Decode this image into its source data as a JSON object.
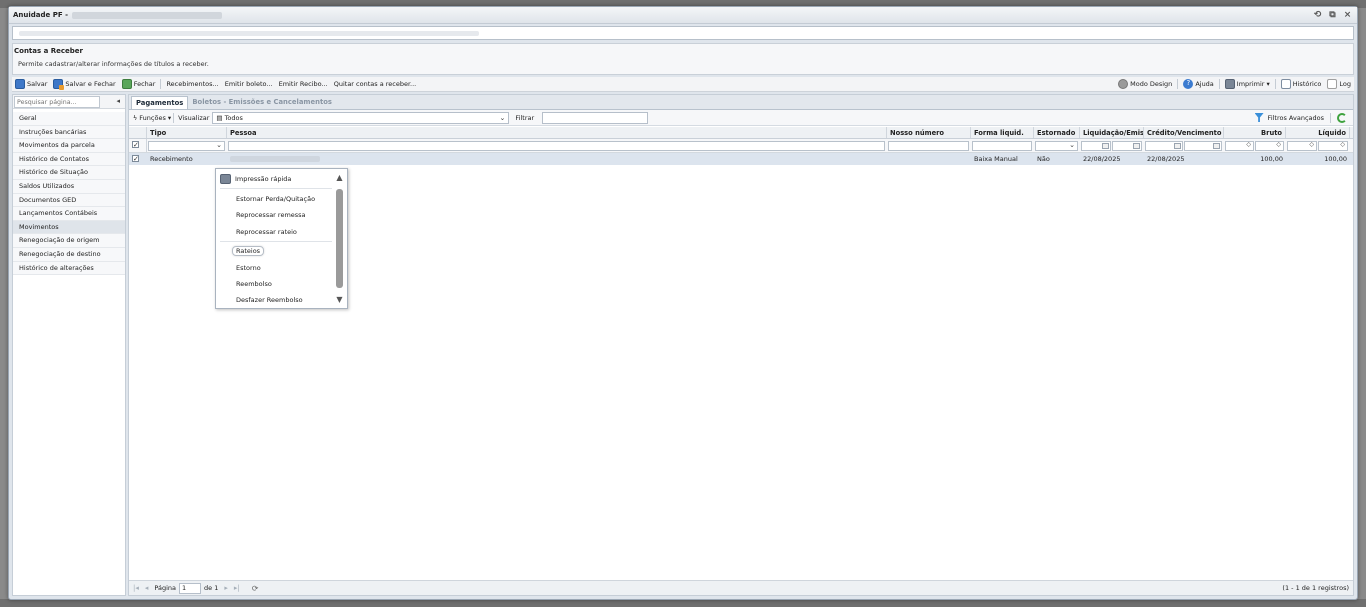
{
  "window": {
    "title": "Anuidade PF -",
    "controls": [
      "refresh-icon",
      "popout-icon",
      "close-icon"
    ]
  },
  "page": {
    "title": "Contas a Receber",
    "description": "Permite cadastrar/alterar informações de títulos a receber."
  },
  "toolbar": {
    "save": "Salvar",
    "save_close": "Salvar e Fechar",
    "close": "Fechar",
    "receipts": "Recebimentos...",
    "emit_boleto": "Emitir boleto...",
    "emit_recibo": "Emitir Recibo...",
    "settle": "Quitar contas a receber...",
    "design_mode": "Modo Design",
    "help": "Ajuda",
    "print": "Imprimir",
    "history": "Histórico",
    "log": "Log"
  },
  "sidebar": {
    "search_placeholder": "Pesquisar página...",
    "items": [
      {
        "label": "Geral"
      },
      {
        "label": "Instruções bancárias"
      },
      {
        "label": "Movimentos da parcela"
      },
      {
        "label": "Histórico de Contatos"
      },
      {
        "label": "Histórico de Situação"
      },
      {
        "label": "Saldos Utilizados"
      },
      {
        "label": "Documentos GED"
      },
      {
        "label": "Lançamentos Contábeis"
      },
      {
        "label": "Movimentos",
        "active": true
      },
      {
        "label": "Renegociação de origem"
      },
      {
        "label": "Renegociação de destino"
      },
      {
        "label": "Histórico de alterações"
      }
    ]
  },
  "tabs": [
    {
      "label": "Pagamentos",
      "active": true
    },
    {
      "label": "Boletos - Emissões e Cancelamentos",
      "active": false
    }
  ],
  "gridbar": {
    "functions": "Funções",
    "view_label": "Visualizar",
    "view_value": "Todos",
    "filter_label": "Filtrar",
    "advanced_filters": "Filtros Avançados"
  },
  "grid": {
    "columns": [
      "Tipo",
      "Pessoa",
      "Nosso número",
      "Forma liquid.",
      "Estornado",
      "Liquidação/Emis",
      "Crédito/Vencimento",
      "Bruto",
      "Líquido"
    ],
    "rows": [
      {
        "tipo": "Recebimento",
        "nosso_numero": "",
        "forma": "Baixa Manual",
        "estornado": "Não",
        "liquidacao": "22/08/2025",
        "credito": "22/08/2025",
        "bruto": "100,00",
        "liquido": "100,00"
      }
    ]
  },
  "context_menu": {
    "items": [
      "Impressão rápida",
      "Estornar Perda/Quitação",
      "Reprocessar remessa",
      "Reprocessar rateio",
      "Rateios",
      "Estorno",
      "Reembolso",
      "Desfazer Reembolso"
    ]
  },
  "pager": {
    "page_label": "Página",
    "page_value": "1",
    "of_label": "de 1",
    "info": "(1 - 1 de 1 registros)"
  },
  "colors": {
    "accent": "#3f78c8",
    "selected_row": "#dce4ee",
    "window_bg": "#dfe5ec"
  }
}
